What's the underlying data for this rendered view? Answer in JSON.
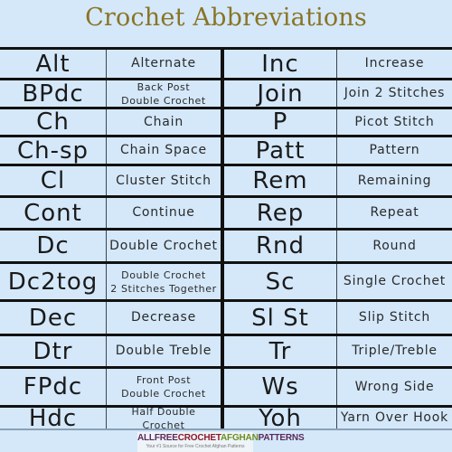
{
  "title": "Crochet Abbreviations",
  "colors": {
    "background": "#d4e8fa",
    "title": "#8a7424",
    "grid_line": "#111111",
    "logo_purple": "#5a2a5a",
    "logo_green": "#6b8e23",
    "logo_red": "#8b1a2a"
  },
  "left_column": [
    {
      "abbr": "Alt",
      "meaning": "Alternate"
    },
    {
      "abbr": "BPdc",
      "meaning": "Back Post\nDouble Crochet"
    },
    {
      "abbr": "Ch",
      "meaning": "Chain"
    },
    {
      "abbr": "Ch-sp",
      "meaning": "Chain Space"
    },
    {
      "abbr": "Cl",
      "meaning": "Cluster Stitch"
    },
    {
      "abbr": "Cont",
      "meaning": "Continue"
    },
    {
      "abbr": "Dc",
      "meaning": "Double Crochet"
    },
    {
      "abbr": "Dc2tog",
      "meaning": "Double Crochet\n2 Stitches Together"
    },
    {
      "abbr": "Dec",
      "meaning": "Decrease"
    },
    {
      "abbr": "Dtr",
      "meaning": "Double Treble"
    },
    {
      "abbr": "FPdc",
      "meaning": "Front Post\nDouble Crochet"
    },
    {
      "abbr": "Hdc",
      "meaning": "Half Double\nCrochet"
    }
  ],
  "right_column": [
    {
      "abbr": "Inc",
      "meaning": "Increase"
    },
    {
      "abbr": "Join",
      "meaning": "Join 2 Stitches"
    },
    {
      "abbr": "P",
      "meaning": "Picot Stitch"
    },
    {
      "abbr": "Patt",
      "meaning": "Pattern"
    },
    {
      "abbr": "Rem",
      "meaning": "Remaining"
    },
    {
      "abbr": "Rep",
      "meaning": "Repeat"
    },
    {
      "abbr": "Rnd",
      "meaning": "Round"
    },
    {
      "abbr": "Sc",
      "meaning": "Single Crochet"
    },
    {
      "abbr": "Sl St",
      "meaning": "Slip Stitch"
    },
    {
      "abbr": "Tr",
      "meaning": "Triple/Treble"
    },
    {
      "abbr": "Ws",
      "meaning": "Wrong Side"
    },
    {
      "abbr": "Yoh",
      "meaning": "Yarn Over Hook"
    }
  ],
  "logo": {
    "parts": [
      {
        "text": "ALLFREE",
        "color": "#5a2a5a"
      },
      {
        "text": "CROCHET",
        "color": "#8b1a2a"
      },
      {
        "text": "AFGHAN",
        "color": "#6b8e23"
      },
      {
        "text": "PATTERNS",
        "color": "#5a2a5a"
      }
    ],
    "tagline": "Your #1 Source for Free Crochet Afghan Patterns"
  }
}
